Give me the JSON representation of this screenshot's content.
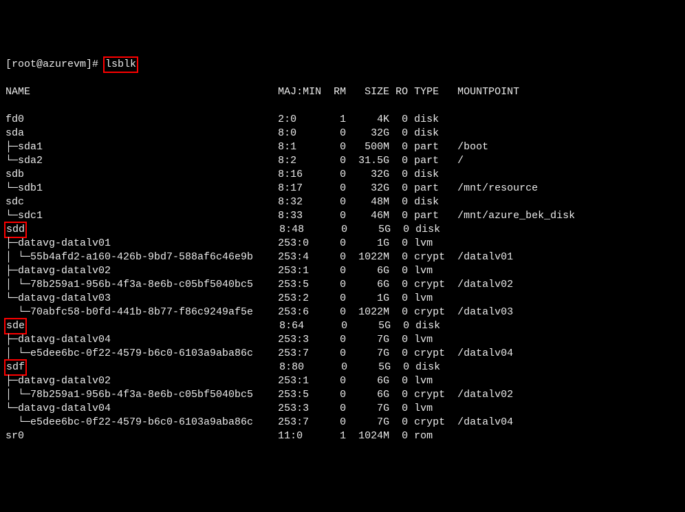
{
  "prompt_prefix": "[root@azurevm]# ",
  "command": "lsblk",
  "columns": {
    "name": "NAME",
    "majmin": "MAJ:MIN",
    "rm": "RM",
    "size": "SIZE",
    "ro": "RO",
    "type": "TYPE",
    "mount": "MOUNTPOINT"
  },
  "highlights": [
    "lsblk",
    "sdd",
    "sde",
    "sdf"
  ],
  "rows": [
    {
      "name": "fd0",
      "maj": "2:0",
      "rm": "1",
      "size": "4K",
      "ro": "0",
      "type": "disk",
      "mount": ""
    },
    {
      "name": "sda",
      "maj": "8:0",
      "rm": "0",
      "size": "32G",
      "ro": "0",
      "type": "disk",
      "mount": ""
    },
    {
      "name": "├─sda1",
      "maj": "8:1",
      "rm": "0",
      "size": "500M",
      "ro": "0",
      "type": "part",
      "mount": "/boot"
    },
    {
      "name": "└─sda2",
      "maj": "8:2",
      "rm": "0",
      "size": "31.5G",
      "ro": "0",
      "type": "part",
      "mount": "/"
    },
    {
      "name": "sdb",
      "maj": "8:16",
      "rm": "0",
      "size": "32G",
      "ro": "0",
      "type": "disk",
      "mount": ""
    },
    {
      "name": "└─sdb1",
      "maj": "8:17",
      "rm": "0",
      "size": "32G",
      "ro": "0",
      "type": "part",
      "mount": "/mnt/resource"
    },
    {
      "name": "sdc",
      "maj": "8:32",
      "rm": "0",
      "size": "48M",
      "ro": "0",
      "type": "disk",
      "mount": ""
    },
    {
      "name": "└─sdc1",
      "maj": "8:33",
      "rm": "0",
      "size": "46M",
      "ro": "0",
      "type": "part",
      "mount": "/mnt/azure_bek_disk"
    },
    {
      "name": "sdd",
      "maj": "8:48",
      "rm": "0",
      "size": "5G",
      "ro": "0",
      "type": "disk",
      "mount": "",
      "hl": true
    },
    {
      "name": "├─datavg-datalv01",
      "maj": "253:0",
      "rm": "0",
      "size": "1G",
      "ro": "0",
      "type": "lvm",
      "mount": ""
    },
    {
      "name": "│ └─55b4afd2-a160-426b-9bd7-588af6c46e9b",
      "maj": "253:4",
      "rm": "0",
      "size": "1022M",
      "ro": "0",
      "type": "crypt",
      "mount": "/datalv01"
    },
    {
      "name": "├─datavg-datalv02",
      "maj": "253:1",
      "rm": "0",
      "size": "6G",
      "ro": "0",
      "type": "lvm",
      "mount": ""
    },
    {
      "name": "│ └─78b259a1-956b-4f3a-8e6b-c05bf5040bc5",
      "maj": "253:5",
      "rm": "0",
      "size": "6G",
      "ro": "0",
      "type": "crypt",
      "mount": "/datalv02"
    },
    {
      "name": "└─datavg-datalv03",
      "maj": "253:2",
      "rm": "0",
      "size": "1G",
      "ro": "0",
      "type": "lvm",
      "mount": ""
    },
    {
      "name": "  └─70abfc58-b0fd-441b-8b77-f86c9249af5e",
      "maj": "253:6",
      "rm": "0",
      "size": "1022M",
      "ro": "0",
      "type": "crypt",
      "mount": "/datalv03"
    },
    {
      "name": "sde",
      "maj": "8:64",
      "rm": "0",
      "size": "5G",
      "ro": "0",
      "type": "disk",
      "mount": "",
      "hl": true
    },
    {
      "name": "├─datavg-datalv04",
      "maj": "253:3",
      "rm": "0",
      "size": "7G",
      "ro": "0",
      "type": "lvm",
      "mount": ""
    },
    {
      "name": "│ └─e5dee6bc-0f22-4579-b6c0-6103a9aba86c",
      "maj": "253:7",
      "rm": "0",
      "size": "7G",
      "ro": "0",
      "type": "crypt",
      "mount": "/datalv04"
    },
    {
      "name": "sdf",
      "maj": "8:80",
      "rm": "0",
      "size": "5G",
      "ro": "0",
      "type": "disk",
      "mount": "",
      "hl": true
    },
    {
      "name": "├─datavg-datalv02",
      "maj": "253:1",
      "rm": "0",
      "size": "6G",
      "ro": "0",
      "type": "lvm",
      "mount": ""
    },
    {
      "name": "│ └─78b259a1-956b-4f3a-8e6b-c05bf5040bc5",
      "maj": "253:5",
      "rm": "0",
      "size": "6G",
      "ro": "0",
      "type": "crypt",
      "mount": "/datalv02"
    },
    {
      "name": "└─datavg-datalv04",
      "maj": "253:3",
      "rm": "0",
      "size": "7G",
      "ro": "0",
      "type": "lvm",
      "mount": ""
    },
    {
      "name": "  └─e5dee6bc-0f22-4579-b6c0-6103a9aba86c",
      "maj": "253:7",
      "rm": "0",
      "size": "7G",
      "ro": "0",
      "type": "crypt",
      "mount": "/datalv04"
    },
    {
      "name": "sr0",
      "maj": "11:0",
      "rm": "1",
      "size": "1024M",
      "ro": "0",
      "type": "rom",
      "mount": ""
    }
  ]
}
